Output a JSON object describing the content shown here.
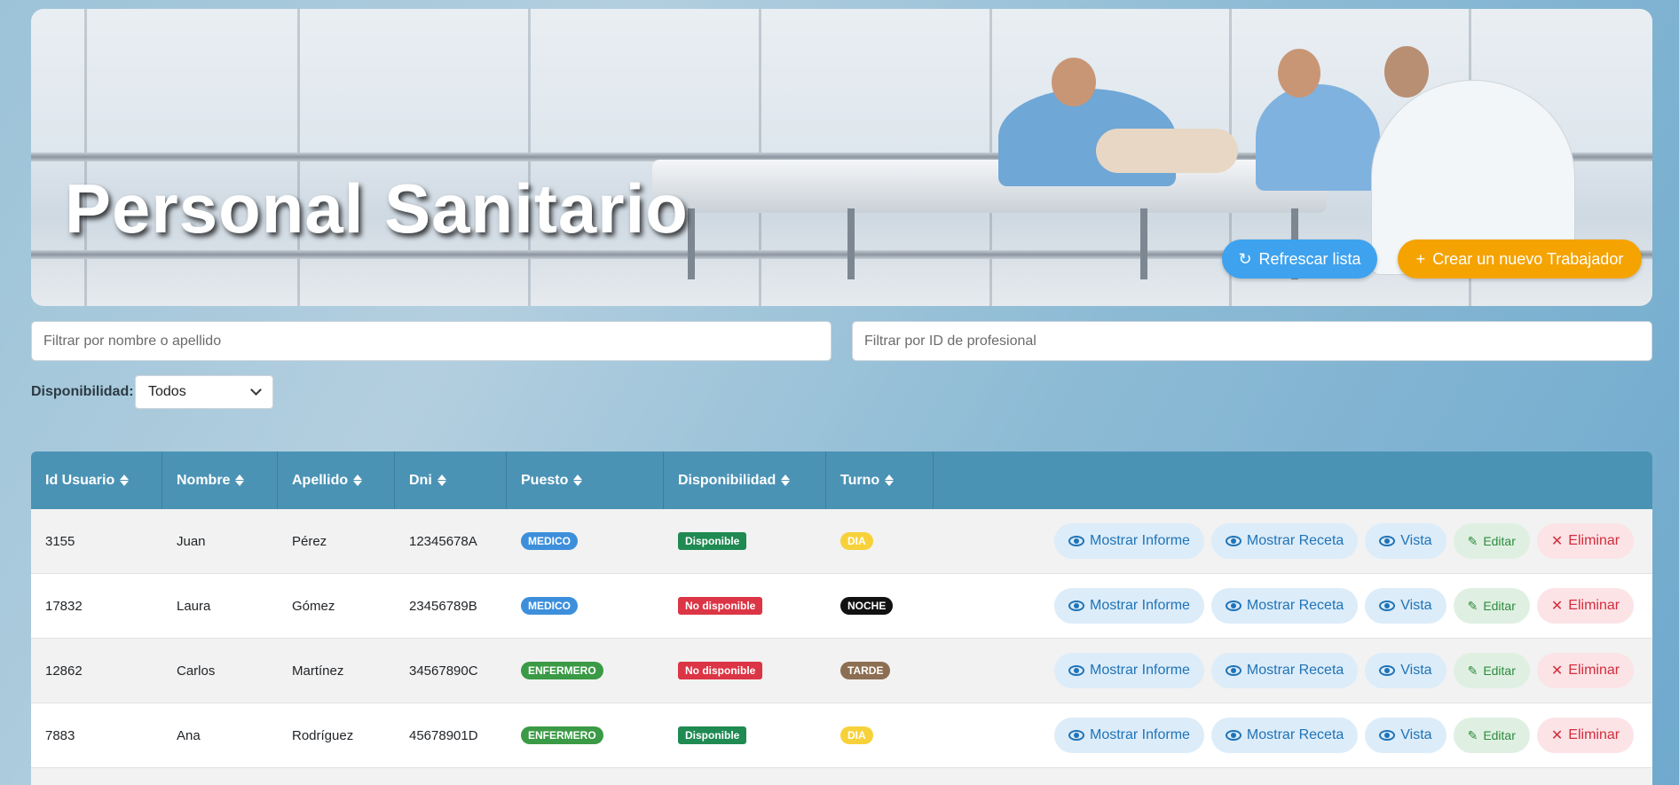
{
  "header": {
    "title": "Personal Sanitario",
    "refresh_label": "Refrescar lista",
    "create_label": "Crear un nuevo Trabajador"
  },
  "filters": {
    "name_placeholder": "Filtrar por nombre o apellido",
    "id_placeholder": "Filtrar por ID de profesional",
    "availability_label": "Disponibilidad:",
    "availability_value": "Todos"
  },
  "table": {
    "columns": [
      "Id Usuario",
      "Nombre",
      "Apellido",
      "Dni",
      "Puesto",
      "Disponibilidad",
      "Turno"
    ],
    "actions": {
      "report": "Mostrar Informe",
      "recipe": "Mostrar Receta",
      "view": "Vista",
      "edit": "Editar",
      "delete": "Eliminar"
    },
    "rows": [
      {
        "id": "3155",
        "nombre": "Juan",
        "apellido": "Pérez",
        "dni": "12345678A",
        "puesto": "MEDICO",
        "disponibilidad": "Disponible",
        "turno": "DIA"
      },
      {
        "id": "17832",
        "nombre": "Laura",
        "apellido": "Gómez",
        "dni": "23456789B",
        "puesto": "MEDICO",
        "disponibilidad": "No disponible",
        "turno": "NOCHE"
      },
      {
        "id": "12862",
        "nombre": "Carlos",
        "apellido": "Martínez",
        "dni": "34567890C",
        "puesto": "ENFERMERO",
        "disponibilidad": "No disponible",
        "turno": "TARDE"
      },
      {
        "id": "7883",
        "nombre": "Ana",
        "apellido": "Rodríguez",
        "dni": "45678901D",
        "puesto": "ENFERMERO",
        "disponibilidad": "Disponible",
        "turno": "DIA"
      }
    ]
  },
  "colors": {
    "medico": "#3d8fdb",
    "enfermero": "#3a9a45",
    "disponible": "#1f8a52",
    "no_disponible": "#dc3545",
    "dia": "#f7d13a",
    "noche": "#111111",
    "tarde": "#8c6e52"
  }
}
